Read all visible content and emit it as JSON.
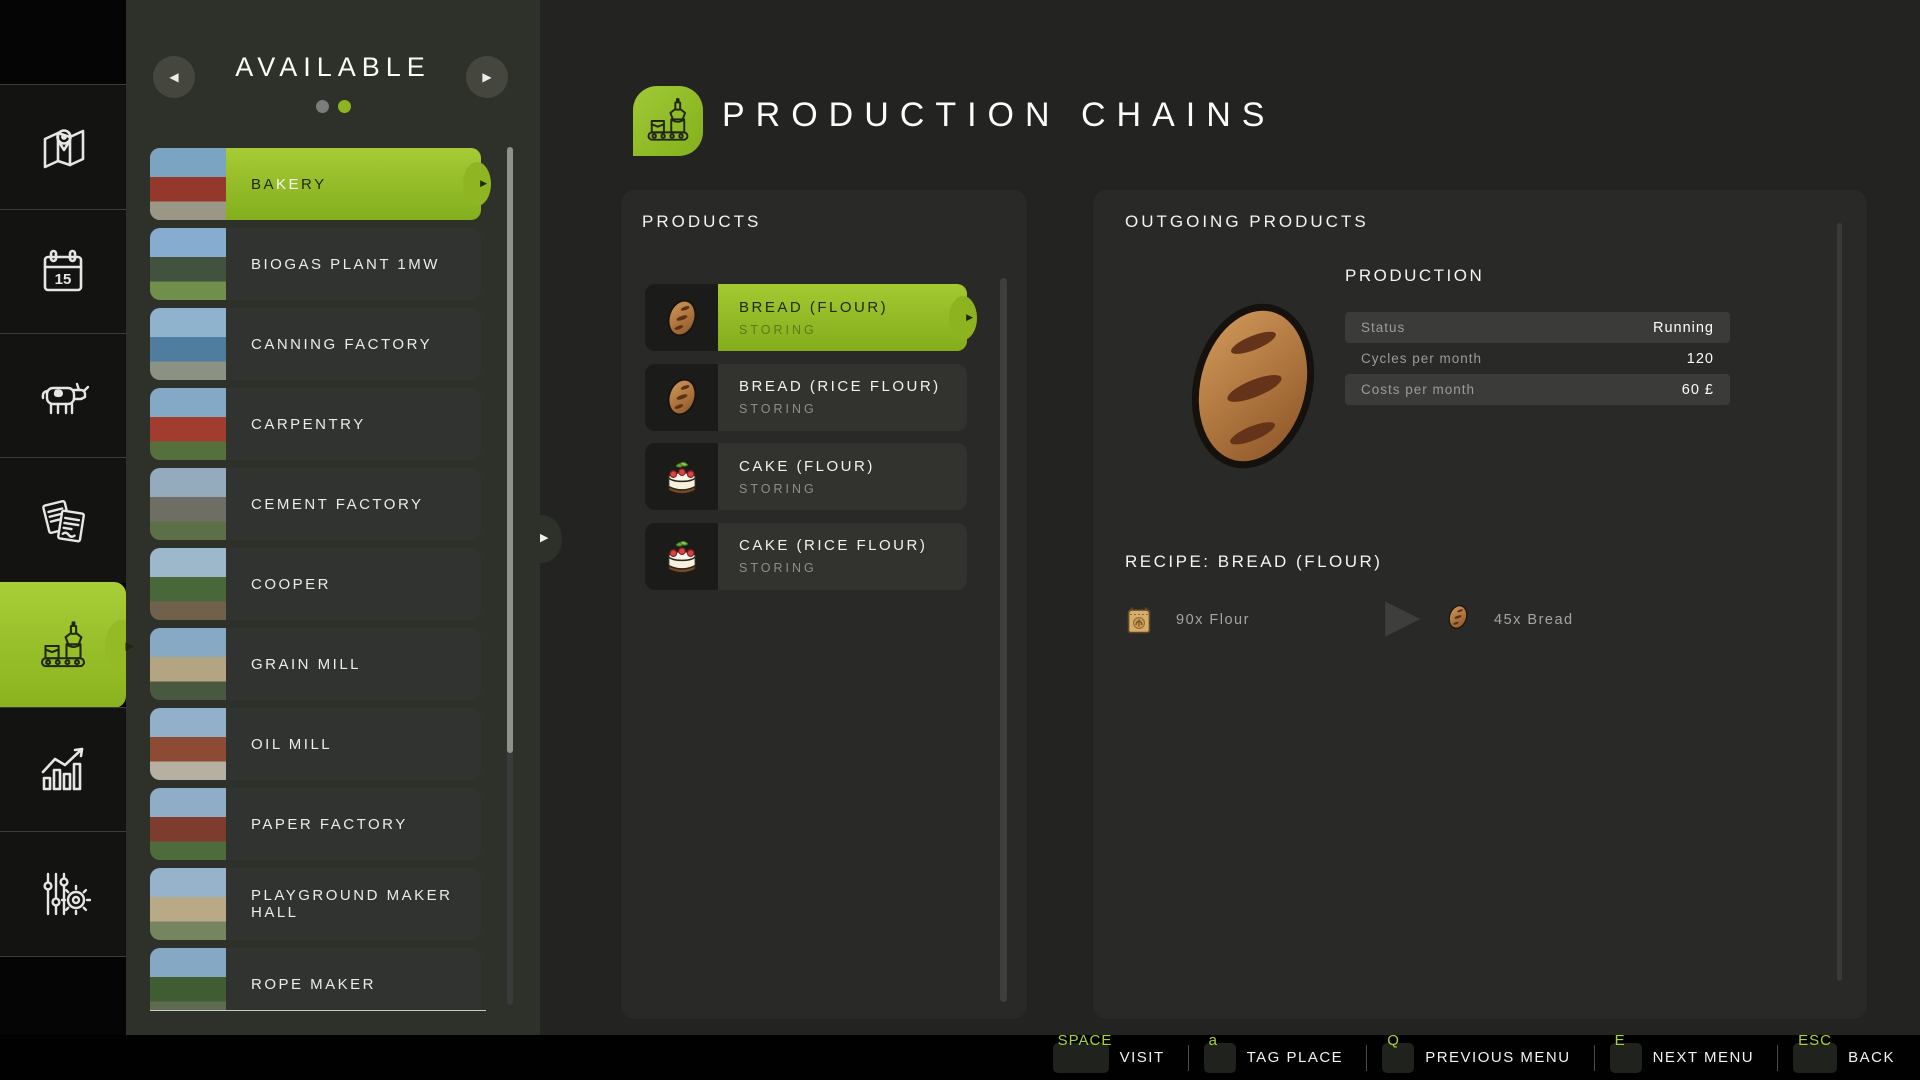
{
  "app": {
    "title": "PRODUCTION CHAINS"
  },
  "colors": {
    "accent_green": "#8fb824",
    "green_gradient_top": "#a6cb35",
    "green_gradient_bottom": "#84ae1d",
    "key_hint_green": "#a5d335",
    "panel_bg": "#292927",
    "status_row_bg": "#3b3b39"
  },
  "sidebar": {
    "items": [
      {
        "id": "map",
        "icon": "map-icon",
        "selected": false
      },
      {
        "id": "calendar",
        "icon": "calendar-icon",
        "badge": "15",
        "selected": false
      },
      {
        "id": "animals",
        "icon": "cow-icon",
        "selected": false
      },
      {
        "id": "contracts",
        "icon": "documents-icon",
        "selected": false
      },
      {
        "id": "production-chains",
        "icon": "production-icon",
        "selected": true
      },
      {
        "id": "statistics",
        "icon": "chart-icon",
        "selected": false
      },
      {
        "id": "settings",
        "icon": "sliders-gear-icon",
        "selected": false
      }
    ]
  },
  "available_panel": {
    "title": "AVAILABLE",
    "pagination": [
      {
        "active": false
      },
      {
        "active": true
      }
    ],
    "buildings": [
      {
        "label": "BAKERY",
        "selected": true,
        "label_parts": [
          {
            "t": "BA",
            "light": false
          },
          {
            "t": "KE",
            "light": true
          },
          {
            "t": "RY",
            "light": false
          }
        ],
        "thumb": [
          "#7ba3c2",
          "#94382c",
          "#9b9787"
        ]
      },
      {
        "label": "BIOGAS PLANT 1MW",
        "selected": false,
        "thumb": [
          "#86add0",
          "#41523f",
          "#6f8f4a"
        ]
      },
      {
        "label": "CANNING FACTORY",
        "selected": false,
        "thumb": [
          "#8fb2cd",
          "#4f7da0",
          "#8b9284"
        ]
      },
      {
        "label": "CARPENTRY",
        "selected": false,
        "thumb": [
          "#83a9c6",
          "#a23c2e",
          "#55703b"
        ]
      },
      {
        "label": "CEMENT FACTORY",
        "selected": false,
        "thumb": [
          "#93abbd",
          "#6e6e64",
          "#5d6f48"
        ]
      },
      {
        "label": "COOPER",
        "selected": false,
        "thumb": [
          "#9db7cb",
          "#49683a",
          "#71604b"
        ]
      },
      {
        "label": "GRAIN MILL",
        "selected": false,
        "thumb": [
          "#88a9c4",
          "#b3a582",
          "#49593f"
        ]
      },
      {
        "label": "OIL MILL",
        "selected": false,
        "thumb": [
          "#92b0c9",
          "#8d4b34",
          "#b5b0a2"
        ]
      },
      {
        "label": "PAPER FACTORY",
        "selected": false,
        "thumb": [
          "#8fadc7",
          "#7e3c2e",
          "#4e6b3c"
        ]
      },
      {
        "label": "PLAYGROUND MAKER HALL",
        "selected": false,
        "thumb": [
          "#97b3cc",
          "#b9a987",
          "#75855f"
        ]
      },
      {
        "label": "ROPE MAKER",
        "selected": false,
        "thumb": [
          "#85a8c4",
          "#3f5c33",
          "#5d6b50"
        ]
      }
    ]
  },
  "products_panel": {
    "title": "PRODUCTS",
    "items": [
      {
        "label": "BREAD (FLOUR)",
        "status": "STORING",
        "icon": "bread-icon",
        "selected": true
      },
      {
        "label": "BREAD (RICE FLOUR)",
        "status": "STORING",
        "icon": "bread-icon",
        "selected": false
      },
      {
        "label": "CAKE (FLOUR)",
        "status": "STORING",
        "icon": "cake-icon",
        "selected": false
      },
      {
        "label": "CAKE (RICE FLOUR)",
        "status": "STORING",
        "icon": "cake-icon",
        "selected": false
      }
    ]
  },
  "outgoing_panel": {
    "title": "OUTGOING PRODUCTS",
    "production": {
      "title": "PRODUCTION",
      "rows": [
        {
          "label": "Status",
          "value": "Running",
          "shaded": true
        },
        {
          "label": "Cycles per month",
          "value": "120",
          "shaded": false
        },
        {
          "label": "Costs per month",
          "value": "60 £",
          "shaded": true
        }
      ]
    },
    "recipe": {
      "title": "RECIPE: BREAD (FLOUR)",
      "input": {
        "text": "90x Flour",
        "icon": "flour-bag-icon"
      },
      "output": {
        "text": "45x Bread",
        "icon": "bread-icon"
      }
    }
  },
  "bottom_bar": {
    "hints": [
      {
        "key": "SPACE",
        "label": "VISIT"
      },
      {
        "key": "a",
        "label": "TAG PLACE"
      },
      {
        "key": "Q",
        "label": "PREVIOUS MENU"
      },
      {
        "key": "E",
        "label": "NEXT MENU"
      },
      {
        "key": "ESC",
        "label": "BACK"
      }
    ]
  }
}
